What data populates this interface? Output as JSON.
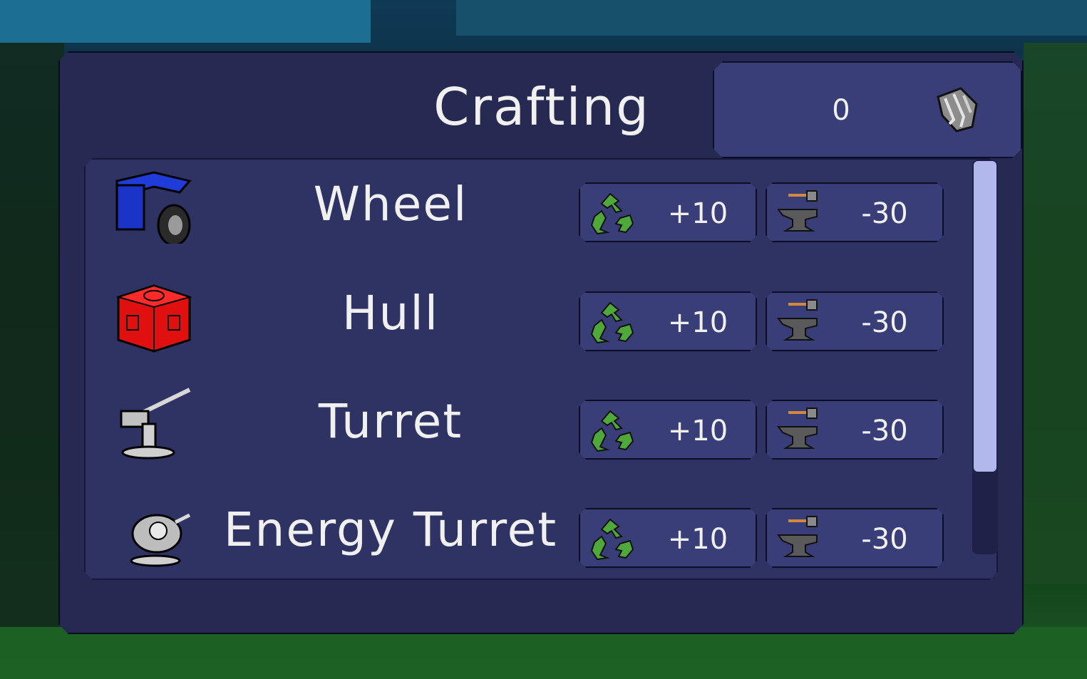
{
  "window": {
    "title": "Crafting"
  },
  "scrap": {
    "count": "0",
    "icon": "scrap-metal-icon"
  },
  "items": [
    {
      "name": "Wheel",
      "icon": "wheel-part-icon",
      "recycle": "+10",
      "craft": "-30"
    },
    {
      "name": "Hull",
      "icon": "hull-part-icon",
      "recycle": "+10",
      "craft": "-30"
    },
    {
      "name": "Turret",
      "icon": "turret-part-icon",
      "recycle": "+10",
      "craft": "-30"
    },
    {
      "name": "Energy Turret",
      "icon": "energy-turret-part-icon",
      "recycle": "+10",
      "craft": "-30"
    }
  ],
  "actions": {
    "recycle_icon": "recycle-icon",
    "craft_icon": "anvil-icon"
  },
  "scrollbar": {
    "position": 0.0,
    "visible_fraction": 0.78
  },
  "colors": {
    "panel": "#262a52",
    "list": "#2f3364",
    "pill": "#3a3e78",
    "text": "#f0f0f0",
    "scroll_thumb": "#b3b8ec",
    "recycle_green": "#4fa83a"
  }
}
